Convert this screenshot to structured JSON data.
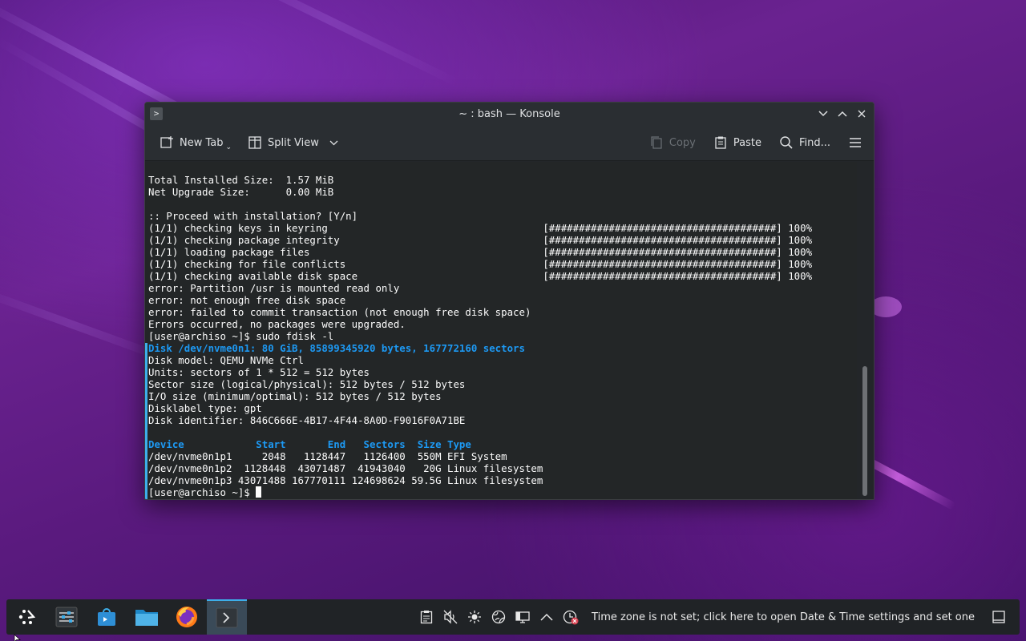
{
  "window": {
    "title": "~ : bash — Konsole"
  },
  "toolbar": {
    "new_tab": "New Tab",
    "split_view": "Split View",
    "copy": "Copy",
    "paste": "Paste",
    "find": "Find..."
  },
  "terminal": {
    "lines": [
      {
        "text": "Total Installed Size:  1.57 MiB",
        "style": "normal"
      },
      {
        "text": "Net Upgrade Size:      0.00 MiB",
        "style": "normal"
      },
      {
        "text": "",
        "style": "normal"
      },
      {
        "text": ":: Proceed with installation? [Y/n]",
        "style": "normal"
      },
      {
        "text": "(1/1) checking keys in keyring                                    [######################################] 100%",
        "style": "normal"
      },
      {
        "text": "(1/1) checking package integrity                                  [######################################] 100%",
        "style": "normal"
      },
      {
        "text": "(1/1) loading package files                                       [######################################] 100%",
        "style": "normal"
      },
      {
        "text": "(1/1) checking for file conflicts                                 [######################################] 100%",
        "style": "normal"
      },
      {
        "text": "(1/1) checking available disk space                               [######################################] 100%",
        "style": "normal"
      },
      {
        "text": "error: Partition /usr is mounted read only",
        "style": "normal"
      },
      {
        "text": "error: not enough free disk space",
        "style": "normal"
      },
      {
        "text": "error: failed to commit transaction (not enough free disk space)",
        "style": "normal"
      },
      {
        "text": "Errors occurred, no packages were upgraded.",
        "style": "normal"
      },
      {
        "text": "[user@archiso ~]$ sudo fdisk -l",
        "style": "normal"
      },
      {
        "text": "Disk /dev/nvme0n1: 80 GiB, 85899345920 bytes, 167772160 sectors",
        "style": "blue"
      },
      {
        "text": "Disk model: QEMU NVMe Ctrl",
        "style": "normal"
      },
      {
        "text": "Units: sectors of 1 * 512 = 512 bytes",
        "style": "normal"
      },
      {
        "text": "Sector size (logical/physical): 512 bytes / 512 bytes",
        "style": "normal"
      },
      {
        "text": "I/O size (minimum/optimal): 512 bytes / 512 bytes",
        "style": "normal"
      },
      {
        "text": "Disklabel type: gpt",
        "style": "normal"
      },
      {
        "text": "Disk identifier: 846C666E-4B17-4F44-8A0D-F9016F0A71BE",
        "style": "normal"
      },
      {
        "text": "",
        "style": "normal"
      },
      {
        "text": "Device            Start       End   Sectors  Size Type",
        "style": "blue"
      },
      {
        "text": "/dev/nvme0n1p1     2048   1128447   1126400  550M EFI System",
        "style": "normal"
      },
      {
        "text": "/dev/nvme0n1p2  1128448  43071487  41943040   20G Linux filesystem",
        "style": "normal"
      },
      {
        "text": "/dev/nvme0n1p3 43071488 167770111 124698624 59.5G Linux filesystem",
        "style": "normal"
      }
    ],
    "prompt": "[user@archiso ~]$ "
  },
  "taskbar": {
    "apps": [
      {
        "name": "app-launcher-icon"
      },
      {
        "name": "system-settings-icon"
      },
      {
        "name": "discover-store-icon"
      },
      {
        "name": "file-manager-icon"
      },
      {
        "name": "firefox-icon"
      },
      {
        "name": "konsole-icon"
      }
    ],
    "tray_message": "Time zone is not set; click here to open Date & Time settings and set one"
  },
  "colors": {
    "accent": "#3daee9",
    "terminal_blue": "#1d99f3",
    "terminal_bg": "#232627"
  }
}
